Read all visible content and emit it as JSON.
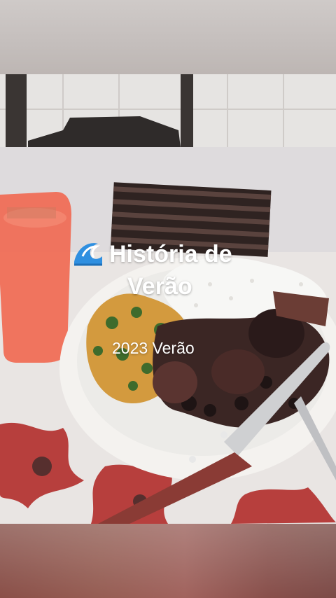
{
  "story": {
    "icon": "water-wave-icon",
    "title_line1": "História de",
    "title_line2": "Verão",
    "subtitle": "2023 Verão"
  },
  "colors": {
    "title_text": "#ffffff",
    "cup": "#f06a52",
    "tablecloth": "#e8e4e2",
    "plate": "#f4f2ef"
  }
}
